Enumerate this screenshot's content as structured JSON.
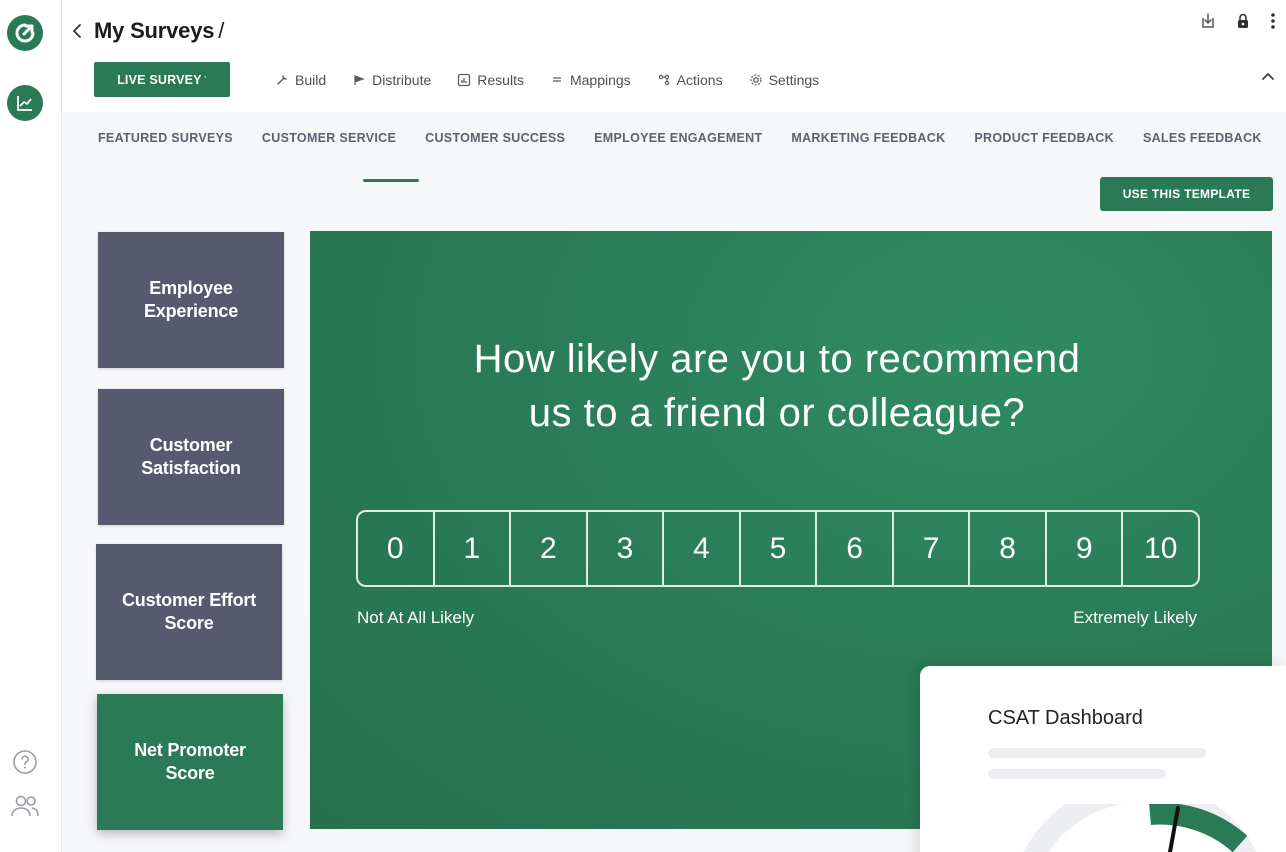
{
  "app": {
    "title": "My Surveys",
    "title_separator": "/"
  },
  "header": {
    "live_button": "LIVE SURVEY",
    "live_button_mark": "ˋ",
    "tabs": [
      {
        "label": "Build",
        "icon": "wrench-icon"
      },
      {
        "label": "Distribute",
        "icon": "send-icon"
      },
      {
        "label": "Results",
        "icon": "bar-chart-icon"
      },
      {
        "label": "Mappings",
        "icon": "lines-icon"
      },
      {
        "label": "Actions",
        "icon": "actions-icon"
      },
      {
        "label": "Settings",
        "icon": "gear-icon"
      }
    ]
  },
  "categories": [
    "FEATURED SURVEYS",
    "CUSTOMER SERVICE",
    "CUSTOMER SUCCESS",
    "EMPLOYEE ENGAGEMENT",
    "MARKETING FEEDBACK",
    "PRODUCT FEEDBACK",
    "SALES FEEDBACK"
  ],
  "use_template_button": "USE THIS TEMPLATE",
  "templates": [
    {
      "label": "Employee Experience",
      "active": false
    },
    {
      "label": "Customer Satisfaction",
      "active": false
    },
    {
      "label": "Customer Effort Score",
      "active": false
    },
    {
      "label": "Net Promoter Score",
      "active": true
    }
  ],
  "preview": {
    "question_line1": "How likely are you to recommend",
    "question_line2": "us to a friend or colleague?",
    "scale": [
      "0",
      "1",
      "2",
      "3",
      "4",
      "5",
      "6",
      "7",
      "8",
      "9",
      "10"
    ],
    "low_label": "Not At All Likely",
    "high_label": "Extremely Likely",
    "dashboard_title": "CSAT Dashboard"
  },
  "colors": {
    "brand_green": "#2a7a56",
    "card_slate": "#575a6e"
  }
}
